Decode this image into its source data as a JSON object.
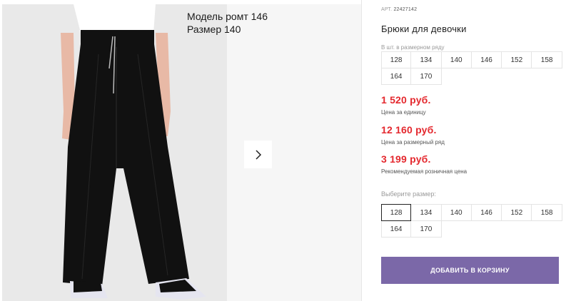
{
  "gallery": {
    "caption_line1": "Модель ромт 146",
    "caption_line2": "Размер 140",
    "next_icon": "chevron-right-icon"
  },
  "product": {
    "sku_label": "АРТ.",
    "sku_value": "22427142",
    "title": "Брюки для девочки",
    "size_row_label": "В шт. в размерном ряду",
    "size_row": [
      "128",
      "134",
      "140",
      "146",
      "152",
      "158",
      "164",
      "170"
    ],
    "price_unit": "1 520 руб.",
    "price_unit_note": "Цена за единицу",
    "price_row": "12 160 руб.",
    "price_row_note": "Цена за размерный ряд",
    "price_retail": "3 199 руб.",
    "price_retail_note": "Рекомендуемая розничная цена",
    "choose_size_label": "Выберите размер:",
    "choose_sizes": [
      "128",
      "134",
      "140",
      "146",
      "152",
      "158",
      "164",
      "170"
    ],
    "selected_size": "128",
    "add_to_cart": "ДОБАВИТЬ В КОРЗИНУ"
  },
  "colors": {
    "accent": "#7b68a8",
    "price": "#e4282e"
  }
}
